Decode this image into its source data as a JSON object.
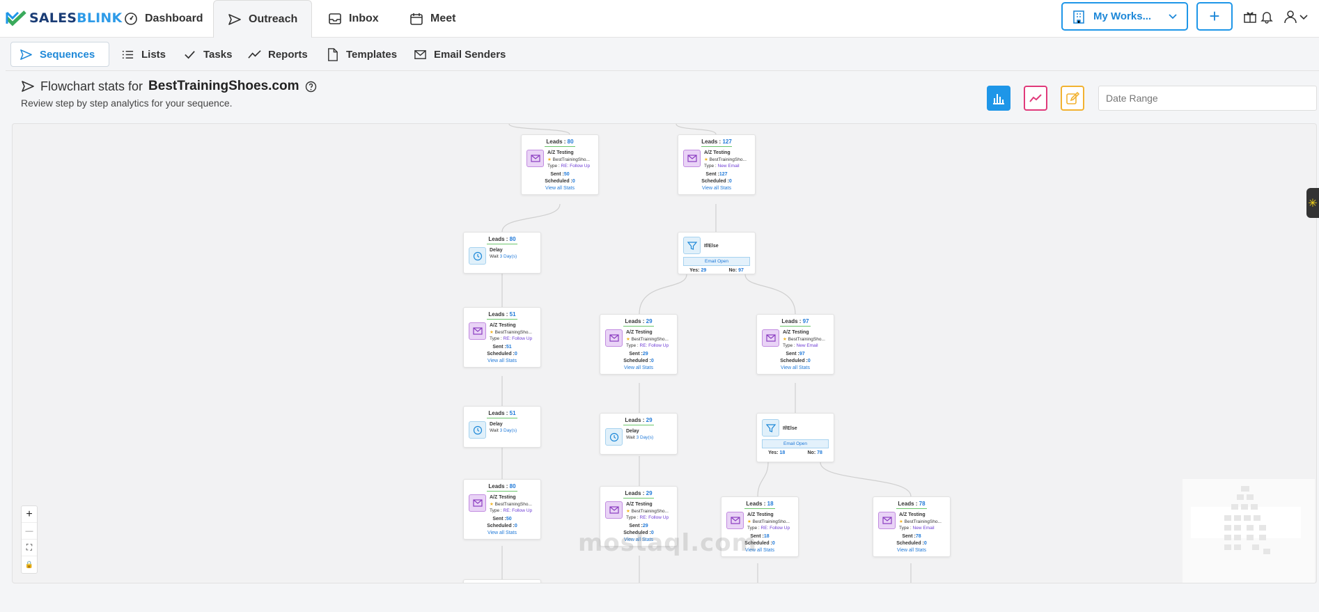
{
  "brand": {
    "name_a": "SALES",
    "name_b": "BLINK"
  },
  "nav": {
    "tabs": [
      {
        "label": "Dashboard"
      },
      {
        "label": "Outreach"
      },
      {
        "label": "Inbox"
      },
      {
        "label": "Meet"
      }
    ],
    "workspace_label": "My Works...",
    "plus_label": "+"
  },
  "subnav": {
    "tabs": [
      {
        "label": "Sequences"
      },
      {
        "label": "Lists"
      },
      {
        "label": "Tasks"
      },
      {
        "label": "Reports"
      },
      {
        "label": "Templates"
      },
      {
        "label": "Email Senders"
      }
    ]
  },
  "header": {
    "title_prefix": "Flowchart stats for",
    "title_domain": "BestTrainingShoes.com",
    "subtitle": "Review step by step analytics for your sequence.",
    "date_placeholder": "Date Range"
  },
  "colors": {
    "accent": "#1e96e8",
    "pink": "#e0397a",
    "yellow": "#f2b230"
  },
  "flow": {
    "labels": {
      "leads": "Leads : ",
      "ab": "A/Z Testing",
      "template": "BestTrainingSho...",
      "type": "Type : ",
      "sent": "Sent :",
      "scheduled": "Scheduled :",
      "view_stats": "View all Stats",
      "delay": "Delay",
      "wait": "Wait ",
      "ifelse": "If/Else",
      "email_open": "Email Open",
      "yes": "Yes: ",
      "no": "No: "
    },
    "nodes": {
      "e1": {
        "leads": "80",
        "type": "RE: Follow Up",
        "sent": "50",
        "scheduled": "0"
      },
      "e2": {
        "leads": "127",
        "type": "New Email",
        "sent": "127",
        "scheduled": "0"
      },
      "d1": {
        "leads": "80",
        "wait": "3 Day(s)"
      },
      "f1": {
        "yes": "29",
        "no": "97"
      },
      "e3": {
        "leads": "51",
        "type": "RE: Follow Up",
        "sent": "51",
        "scheduled": "0"
      },
      "e4": {
        "leads": "29",
        "type": "RE: Follow Up",
        "sent": "29",
        "scheduled": "0"
      },
      "e5": {
        "leads": "97",
        "type": "New Email",
        "sent": "97",
        "scheduled": "0"
      },
      "d2": {
        "leads": "51",
        "wait": "3 Day(s)"
      },
      "d3": {
        "leads": "29",
        "wait": "3 Day(s)"
      },
      "f2": {
        "yes": "18",
        "no": "78"
      },
      "e6": {
        "leads": "80",
        "type": "RE: Follow Up",
        "sent": "50",
        "scheduled": "0"
      },
      "e7": {
        "leads": "29",
        "type": "RE: Follow Up",
        "sent": "29",
        "scheduled": "0"
      },
      "e8": {
        "leads": "18",
        "type": "RE: Follow Up",
        "sent": "18",
        "scheduled": "0"
      },
      "e9": {
        "leads": "78",
        "type": "New Email",
        "sent": "78",
        "scheduled": "0"
      }
    }
  },
  "zoom": {
    "in": "+",
    "out": "—",
    "fit": "⛶",
    "lock": "🔒"
  },
  "watermark": "mostaql.com"
}
